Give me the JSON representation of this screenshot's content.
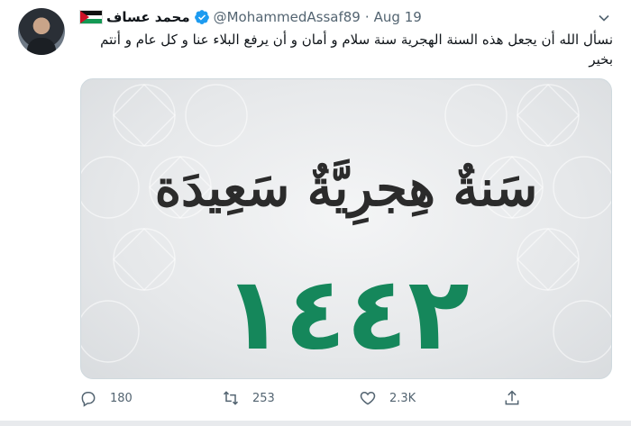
{
  "author": {
    "display_name": "محمد عساف",
    "handle": "@MohammedAssaf89",
    "separator": "·",
    "date": "Aug 19"
  },
  "tweet": {
    "text": "نسأل الله أن يجعل هذه السنة الهجرية سنة سلام و أمان و أن يرفع البلاء عنا و كل عام و أنتم بخير"
  },
  "media": {
    "title": "سَنةٌ هِجرِيَّةٌ سَعِيدَة",
    "year": "١٤٤٢"
  },
  "actions": {
    "reply_count": "180",
    "retweet_count": "253",
    "like_count": "2.3K"
  },
  "colors": {
    "accent": "#1d9bf0",
    "muted": "#536471",
    "year_green": "#15875b"
  },
  "icons": {
    "verified": "verified-badge-icon",
    "caret": "chevron-down-icon",
    "reply": "reply-icon",
    "retweet": "retweet-icon",
    "like": "heart-icon",
    "share": "share-icon"
  }
}
